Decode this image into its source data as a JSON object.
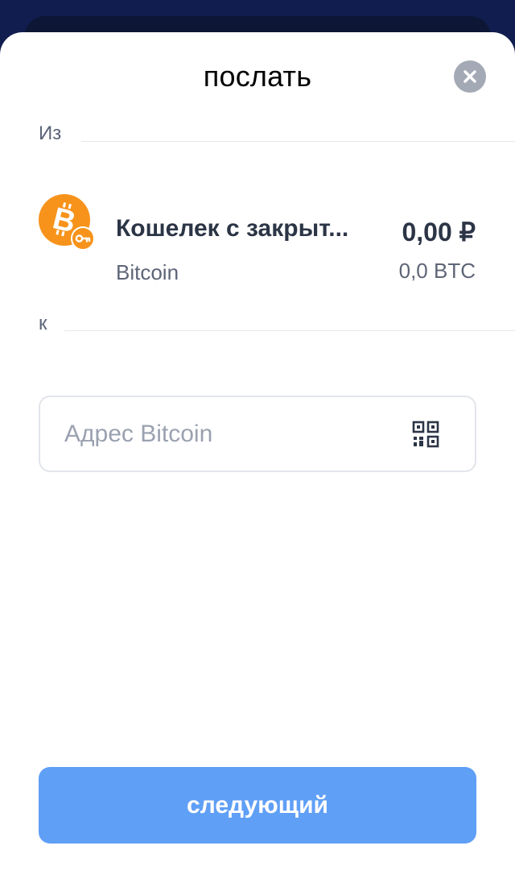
{
  "sheet": {
    "title": "послать",
    "close_icon": "close-icon"
  },
  "from": {
    "label": "Из",
    "wallet": {
      "name": "Кошелек с закрыт...",
      "network": "Bitcoin",
      "fiat_balance": "0,00 ₽",
      "crypto_balance": "0,0 BTC",
      "coin_icon": "bitcoin-icon",
      "badge_icon": "key-icon",
      "coin_color": "#f7931a"
    }
  },
  "to": {
    "label": "к",
    "address": {
      "value": "",
      "placeholder": "Адрес Bitcoin",
      "scan_icon": "qr-code-icon"
    }
  },
  "next_button": {
    "label": "следующий",
    "color": "#5f9ff6"
  }
}
